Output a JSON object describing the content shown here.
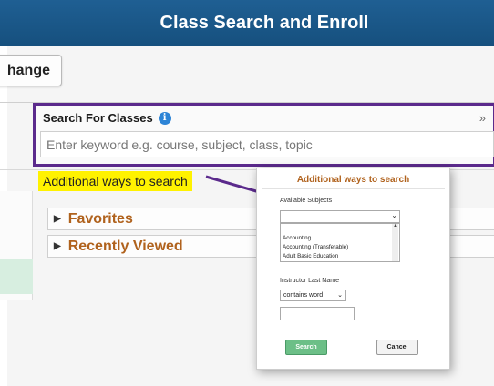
{
  "header": {
    "title": "Class Search and Enroll"
  },
  "toolbar": {
    "change_label": "hange"
  },
  "search": {
    "label": "Search For Classes",
    "info_icon": "i",
    "placeholder": "Enter keyword e.g. course, subject, class, topic",
    "submit_glyph": "»"
  },
  "additional_link": "Additional ways to search",
  "accordions": [
    {
      "label": "Favorites"
    },
    {
      "label": "Recently Viewed"
    }
  ],
  "popup": {
    "title": "Additional ways to search",
    "subjects_label": "Available Subjects",
    "subjects_options": [
      "Accounting",
      "Accounting (Transferable)",
      "Adult Basic Education"
    ],
    "instructor_label": "Instructor Last Name",
    "instructor_operator": "contains word",
    "search_button": "Search",
    "cancel_button": "Cancel"
  },
  "colors": {
    "header_bg": "#1f5f93",
    "highlight_border": "#5b2a8c",
    "accent_orange": "#b0621d",
    "link_highlight": "#fff200",
    "search_btn": "#6cbf87"
  }
}
